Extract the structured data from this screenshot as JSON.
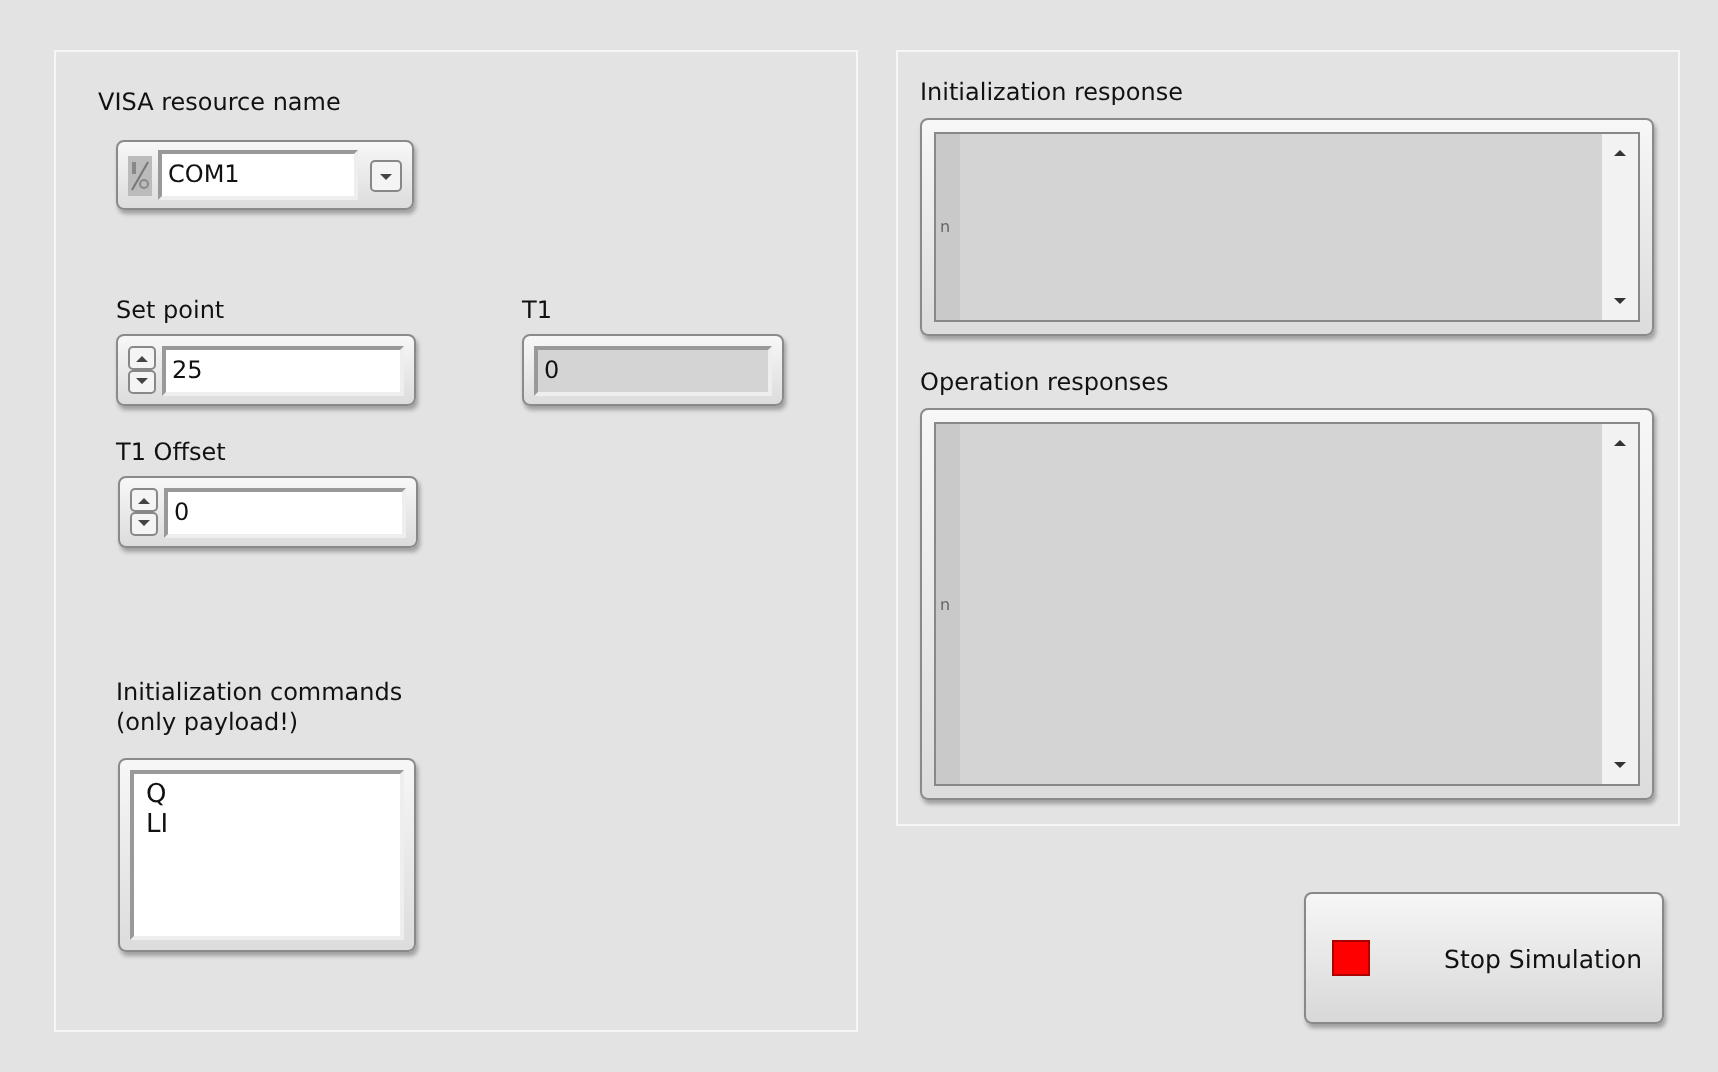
{
  "visa_resource": {
    "label": "VISA resource name",
    "value": "COM1"
  },
  "set_point": {
    "label": "Set point",
    "value": "25"
  },
  "t1": {
    "label": "T1",
    "value": "0"
  },
  "t1_offset": {
    "label": "T1 Offset",
    "value": "0"
  },
  "init_commands": {
    "label": "Initialization commands\n(only payload!)",
    "lines": [
      "Q",
      "LI"
    ]
  },
  "init_response": {
    "label": "Initialization response",
    "index": "n"
  },
  "operation_responses": {
    "label": "Operation responses",
    "index": "n"
  },
  "stop_button": {
    "label": "Stop Simulation"
  }
}
